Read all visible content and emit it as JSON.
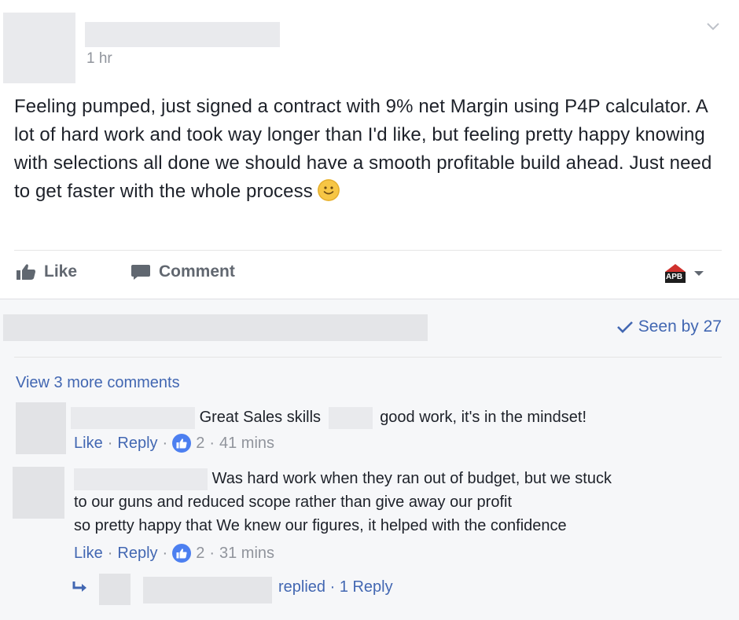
{
  "post": {
    "time": "1 hr",
    "text": "Feeling pumped, just signed a contract with 9% net Margin using P4P calculator. A lot of hard work and took way longer than I'd like, but feeling pretty happy knowing with selections all done we should have a smooth profitable build ahead. Just need to get faster with the whole process",
    "emoji": "smiley-emoji"
  },
  "actions": {
    "like_label": "Like",
    "comment_label": "Comment",
    "page_badge": "APB"
  },
  "seen": {
    "label": "Seen by 27"
  },
  "comments_section": {
    "view_more": "View 3 more comments",
    "comments": [
      {
        "text_a": "Great Sales skills",
        "text_b": "good work, it's in the mindset!",
        "like": "Like",
        "reply": "Reply",
        "reactions": "2",
        "time": "41 mins"
      },
      {
        "text_line1": "Was hard work when they ran out of budget, but we stuck",
        "text_line2": "to our guns and reduced scope rather than give away our profit",
        "text_line3": "so pretty happy that We knew our figures, it helped with the confidence",
        "like": "Like",
        "reply": "Reply",
        "reactions": "2",
        "time": "31 mins"
      }
    ],
    "replies": {
      "label": "replied · 1 Reply"
    }
  }
}
